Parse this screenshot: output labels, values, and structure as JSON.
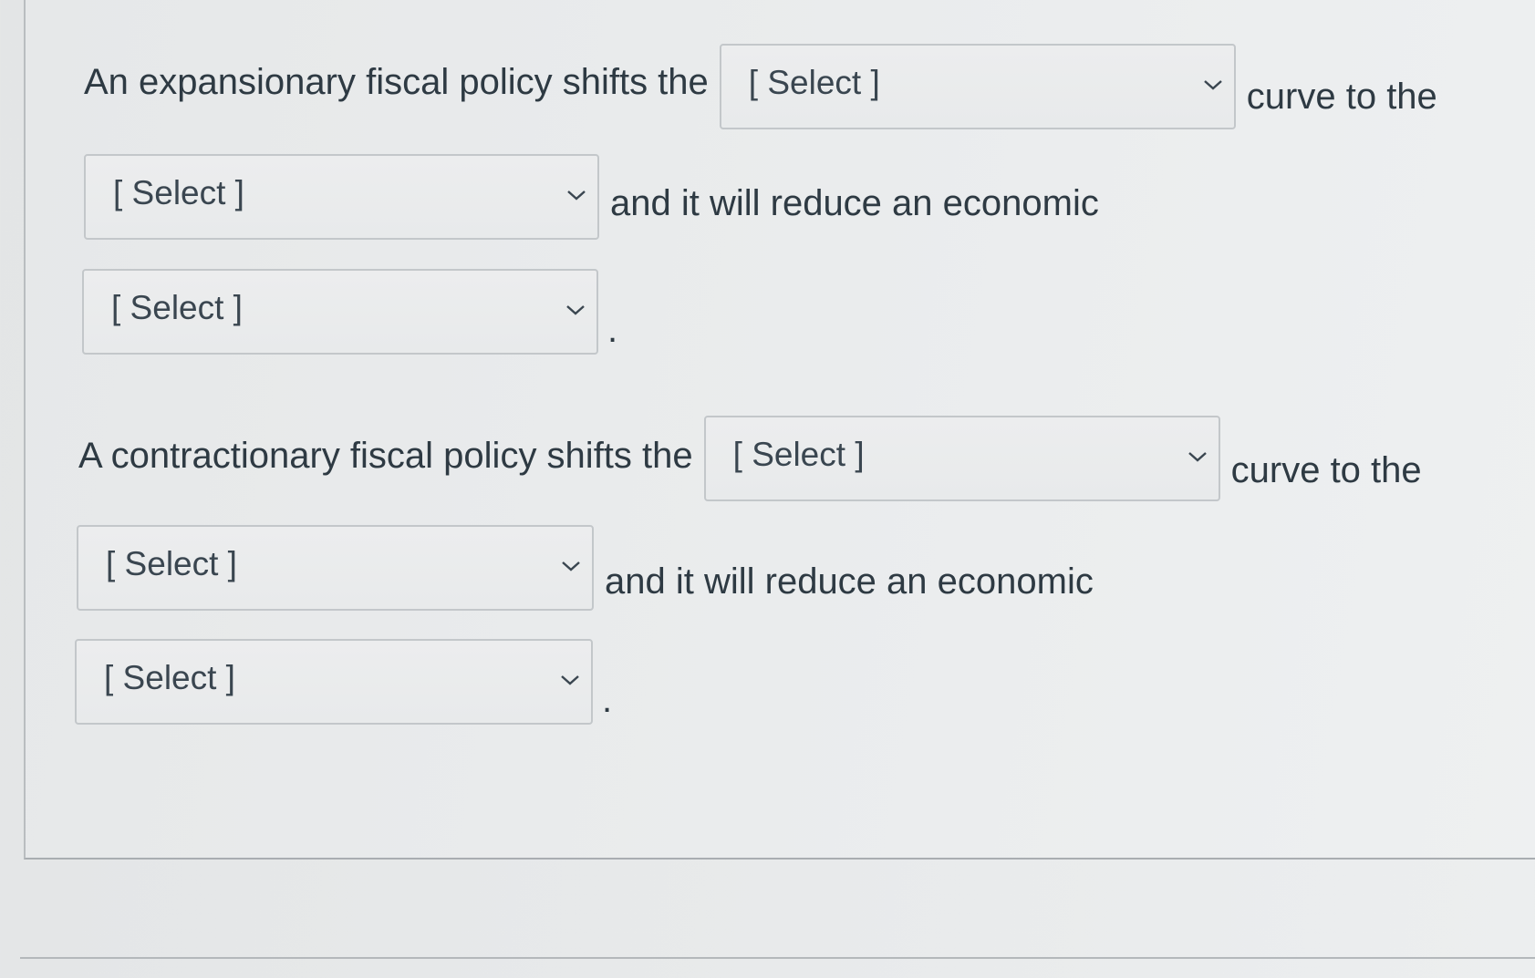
{
  "questions": [
    {
      "lead": "An expansionary fiscal policy shifts the",
      "select_1": "[ Select ]",
      "after_1": "curve to the",
      "select_2": "[ Select ]",
      "after_2": "and it will reduce an economic",
      "select_3": "[ Select ]",
      "end": "."
    },
    {
      "lead": "A contractionary fiscal policy shifts the",
      "select_1": "[ Select ]",
      "after_1": "curve to the",
      "select_2": "[ Select ]",
      "after_2": "and it will reduce an economic",
      "select_3": "[ Select ]",
      "end": "."
    }
  ],
  "icons": {
    "dropdown": "chevron-down-icon"
  }
}
